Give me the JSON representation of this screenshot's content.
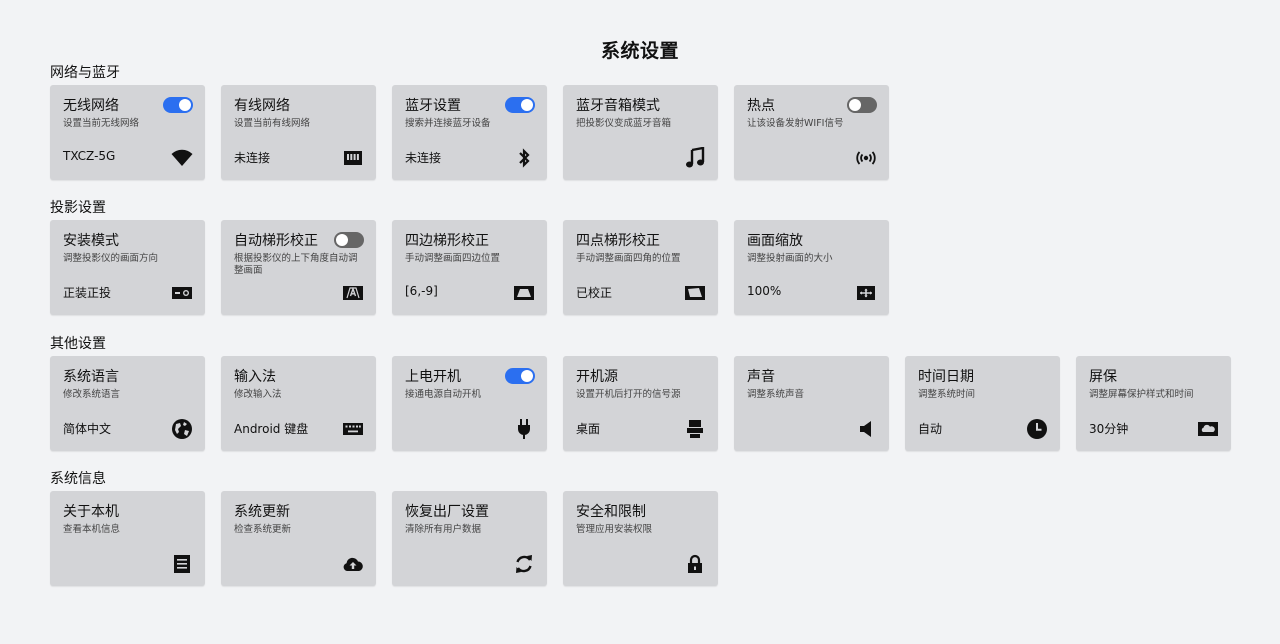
{
  "page": {
    "title": "系统设置"
  },
  "colors": {
    "accent": "#2b6ff0",
    "card_bg": "#d3d4d7",
    "page_bg": "#f2f3f5",
    "toggle_off": "#666666"
  },
  "sections": [
    {
      "title": "网络与蓝牙",
      "cards": [
        {
          "title": "无线网络",
          "desc": "设置当前无线网络",
          "status": "TXCZ-5G",
          "icon": "wifi-icon",
          "toggle": true
        },
        {
          "title": "有线网络",
          "desc": "设置当前有线网络",
          "status": "未连接",
          "icon": "ethernet-icon"
        },
        {
          "title": "蓝牙设置",
          "desc": "搜索并连接蓝牙设备",
          "status": "未连接",
          "icon": "bluetooth-icon",
          "toggle": true
        },
        {
          "title": "蓝牙音箱模式",
          "desc": "把投影仪变成蓝牙音箱",
          "status": "",
          "icon": "music-note-icon"
        },
        {
          "title": "热点",
          "desc": "让该设备发射WIFI信号",
          "status": "",
          "icon": "hotspot-icon",
          "toggle": false
        }
      ]
    },
    {
      "title": "投影设置",
      "cards": [
        {
          "title": "安装模式",
          "desc": "调整投影仪的画面方向",
          "status": "正装正投",
          "icon": "projector-icon"
        },
        {
          "title": "自动梯形校正",
          "desc": "根据投影仪的上下角度自动调整画面",
          "status": "",
          "icon": "auto-keystone-icon",
          "toggle": false
        },
        {
          "title": "四边梯形校正",
          "desc": "手动调整画面四边位置",
          "status": "[6,-9]",
          "icon": "trapezoid-icon"
        },
        {
          "title": "四点梯形校正",
          "desc": "手动调整画面四角的位置",
          "status": "已校正",
          "icon": "four-point-icon"
        },
        {
          "title": "画面缩放",
          "desc": "调整投射画面的大小",
          "status": "100%",
          "icon": "resize-icon"
        }
      ]
    },
    {
      "title": "其他设置",
      "cards": [
        {
          "title": "系统语言",
          "desc": "修改系统语言",
          "status": "简体中文",
          "icon": "globe-icon"
        },
        {
          "title": "输入法",
          "desc": "修改输入法",
          "status": "Android 键盘",
          "icon": "keyboard-icon"
        },
        {
          "title": "上电开机",
          "desc": "接通电源自动开机",
          "status": "",
          "icon": "plug-icon",
          "toggle": true
        },
        {
          "title": "开机源",
          "desc": "设置开机后打开的信号源",
          "status": "桌面",
          "icon": "source-icon"
        },
        {
          "title": "声音",
          "desc": "调整系统声音",
          "status": "",
          "icon": "speaker-icon"
        },
        {
          "title": "时间日期",
          "desc": "调整系统时间",
          "status": "自动",
          "icon": "clock-icon"
        },
        {
          "title": "屏保",
          "desc": "调整屏幕保护样式和时间",
          "status": "30分钟",
          "icon": "screensaver-icon"
        }
      ]
    },
    {
      "title": "系统信息",
      "cards": [
        {
          "title": "关于本机",
          "desc": "查看本机信息",
          "status": "",
          "icon": "document-icon"
        },
        {
          "title": "系统更新",
          "desc": "检查系统更新",
          "status": "",
          "icon": "cloud-upload-icon"
        },
        {
          "title": "恢复出厂设置",
          "desc": "清除所有用户数据",
          "status": "",
          "icon": "refresh-icon"
        },
        {
          "title": "安全和限制",
          "desc": "管理应用安装权限",
          "status": "",
          "icon": "lock-icon"
        }
      ]
    }
  ]
}
